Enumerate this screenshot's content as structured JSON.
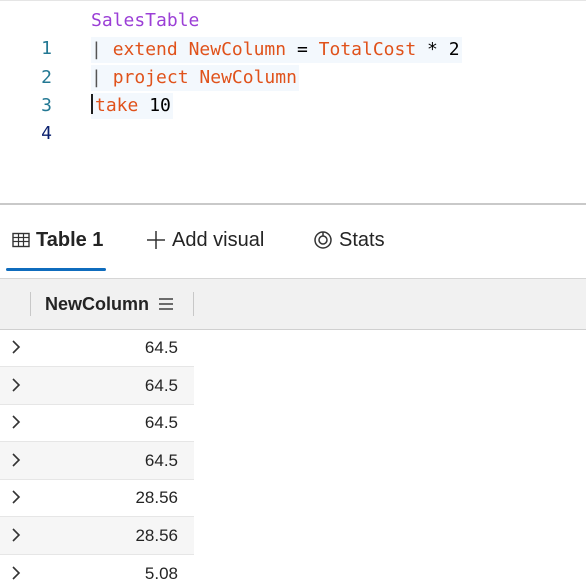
{
  "editor": {
    "lines": [
      {
        "number": "1",
        "table": "SalesTable"
      },
      {
        "number": "2",
        "pipe": "|",
        "keyword": "extend",
        "identifier": "NewColumn",
        "eq": "=",
        "source": "TotalCost",
        "op": "*",
        "value": "2"
      },
      {
        "number": "3",
        "pipe": "|",
        "keyword": "project",
        "identifier": "NewColumn"
      },
      {
        "number": "4",
        "pipe": "|",
        "keyword": "take",
        "value": "10"
      }
    ]
  },
  "tabs": [
    {
      "label": "Table 1",
      "icon": "table-icon",
      "active": true
    },
    {
      "label": "Add visual",
      "icon": "plus-icon",
      "active": false
    },
    {
      "label": "Stats",
      "icon": "stats-icon",
      "active": false
    }
  ],
  "grid": {
    "column": "NewColumn",
    "rows": [
      "64.5",
      "64.5",
      "64.5",
      "64.5",
      "28.56",
      "28.56",
      "5.08"
    ]
  },
  "colors": {
    "table_name": "#9b3fd6",
    "keyword": "#e0521b",
    "line_number": "#237893",
    "tab_accent": "#0f6cbd"
  }
}
